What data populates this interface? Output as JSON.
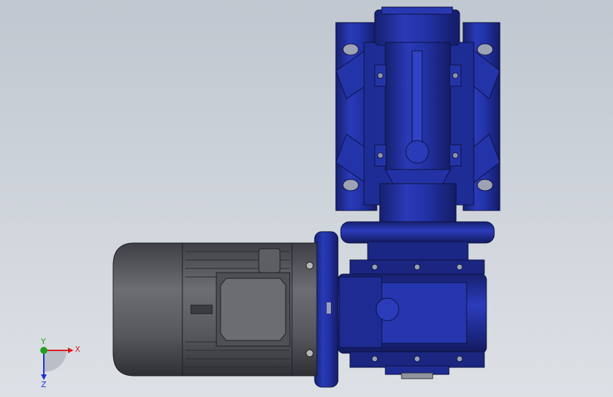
{
  "viewport": {
    "background_top": "#c0c7d0",
    "background_bottom": "#dde1e6"
  },
  "model": {
    "parts": [
      {
        "name": "worm-gearbox-housing",
        "color": "#1f2fa0"
      },
      {
        "name": "helical-prestage-housing",
        "color": "#1f2fa0"
      },
      {
        "name": "electric-motor",
        "color": "#5a5c62"
      }
    ]
  },
  "triad": {
    "x_label": "X",
    "y_label": "Y",
    "z_label": "Z",
    "x_color": "#d81e1e",
    "y_color": "#1ea01e",
    "z_color": "#1a2fd6"
  }
}
